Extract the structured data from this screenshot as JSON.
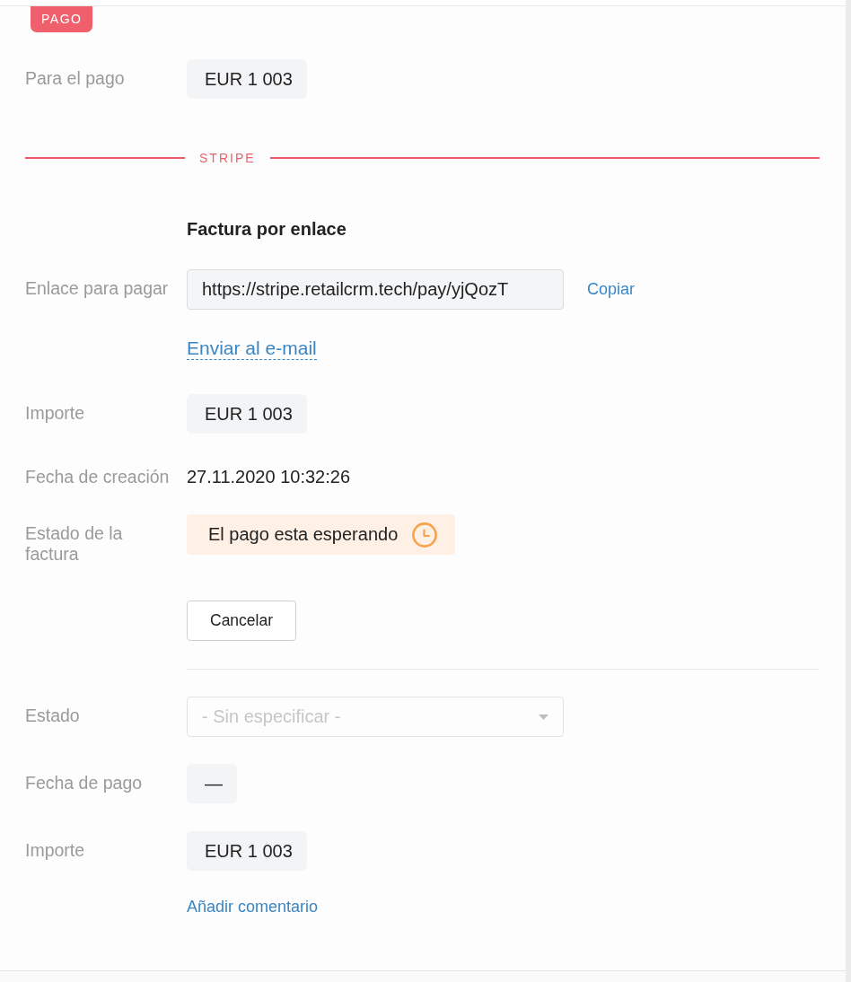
{
  "section_tag": "PAGO",
  "summary": [
    {
      "kind": "chip",
      "label": "Para el pago",
      "value": "EUR 1 003"
    }
  ],
  "provider": {
    "name": "STRIPE",
    "title": "Factura por enlace",
    "rows": [
      {
        "kind": "link",
        "label": "Enlace para pagar",
        "value": "https://stripe.retailcrm.tech/pay/yjQozT",
        "copy": "Copiar",
        "send": "Enviar al e-mail"
      },
      {
        "kind": "chip",
        "label": "Importe",
        "value": "EUR 1 003"
      },
      {
        "kind": "text",
        "label": "Fecha de creación",
        "value": "27.11.2020 10:32:26"
      },
      {
        "kind": "status",
        "label": "Estado de la factura",
        "value": "El pago esta esperando"
      }
    ],
    "cancel_button": "Cancelar"
  },
  "payment": {
    "rows": [
      {
        "kind": "select",
        "label": "Estado",
        "placeholder": "- Sin especificar -"
      },
      {
        "kind": "chip",
        "label": "Fecha de pago",
        "value": "—"
      },
      {
        "kind": "chip",
        "label": "Importe",
        "value": "EUR 1 003"
      }
    ],
    "add_comment": "Añadir comentario"
  }
}
